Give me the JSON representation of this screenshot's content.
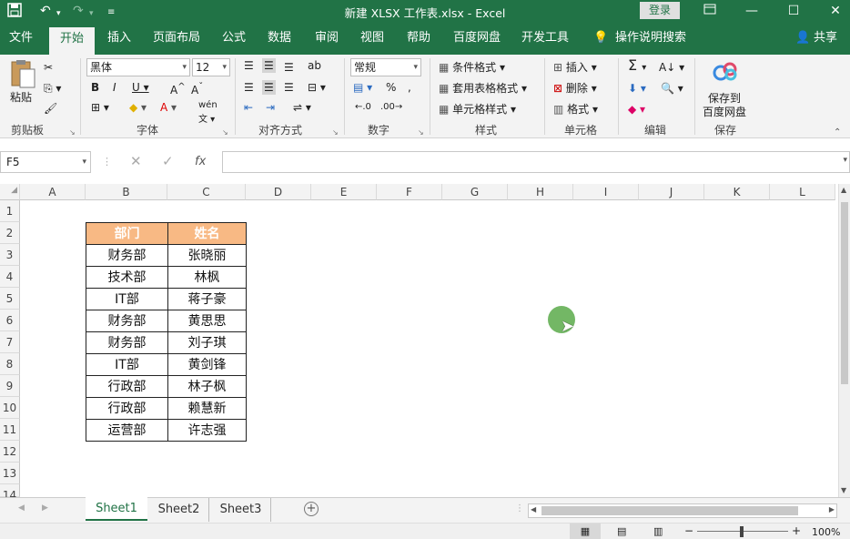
{
  "window": {
    "title": "新建 XLSX 工作表.xlsx  -  Excel",
    "login": "登录"
  },
  "tabs": [
    "文件",
    "开始",
    "插入",
    "页面布局",
    "公式",
    "数据",
    "审阅",
    "视图",
    "帮助",
    "百度网盘",
    "开发工具",
    "操作说明搜索",
    "共享"
  ],
  "ribbon": {
    "font_name": "黑体",
    "font_size": "12",
    "number_format": "常规",
    "paste": "粘贴",
    "cond_format": "条件格式",
    "table_format": "套用表格格式",
    "cell_style": "单元格样式",
    "insert": "插入",
    "delete": "删除",
    "format": "格式",
    "save_to_1": "保存到",
    "save_to_2": "百度网盘",
    "groups": [
      "剪贴板",
      "字体",
      "对齐方式",
      "数字",
      "样式",
      "单元格",
      "编辑",
      "保存"
    ]
  },
  "formula": {
    "name_box": "F5",
    "value": ""
  },
  "columns": [
    "A",
    "B",
    "C",
    "D",
    "E",
    "F",
    "G",
    "H",
    "I",
    "J",
    "K",
    "L"
  ],
  "rows": [
    "1",
    "2",
    "3",
    "4",
    "5",
    "6",
    "7",
    "8",
    "9",
    "10",
    "11",
    "12",
    "13",
    "14"
  ],
  "table": {
    "headers": [
      "部门",
      "姓名"
    ],
    "rows": [
      [
        "财务部",
        "张晓丽"
      ],
      [
        "技术部",
        "林枫"
      ],
      [
        "IT部",
        "蒋子豪"
      ],
      [
        "财务部",
        "黄思思"
      ],
      [
        "财务部",
        "刘子琪"
      ],
      [
        "IT部",
        "黄剑锋"
      ],
      [
        "行政部",
        "林子枫"
      ],
      [
        "行政部",
        "赖慧新"
      ],
      [
        "运营部",
        "许志强"
      ]
    ]
  },
  "sheets": [
    "Sheet1",
    "Sheet2",
    "Sheet3"
  ],
  "status": {
    "zoom": "100%"
  },
  "colors": {
    "excel_green": "#217346",
    "header_fill": "#f8b984",
    "cursor_highlight": "#5aaa4a"
  }
}
